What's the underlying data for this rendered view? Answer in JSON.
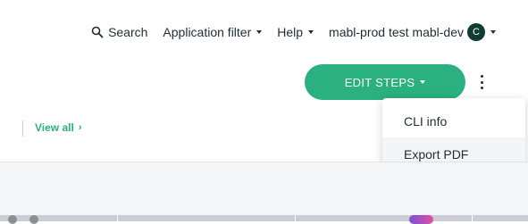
{
  "topnav": {
    "search_label": "Search",
    "app_filter_label": "Application filter",
    "help_label": "Help",
    "workspace_label": "mabl-prod test mabl-dev",
    "avatar_initial": "C"
  },
  "toolbar": {
    "edit_steps_label": "EDIT STEPS"
  },
  "menu": {
    "items": [
      {
        "label": "CLI info"
      },
      {
        "label": "Export PDF"
      }
    ]
  },
  "view_all": {
    "label": "View all"
  },
  "colors": {
    "accent": "#2bb07f",
    "avatar_bg": "#0e3d33"
  }
}
